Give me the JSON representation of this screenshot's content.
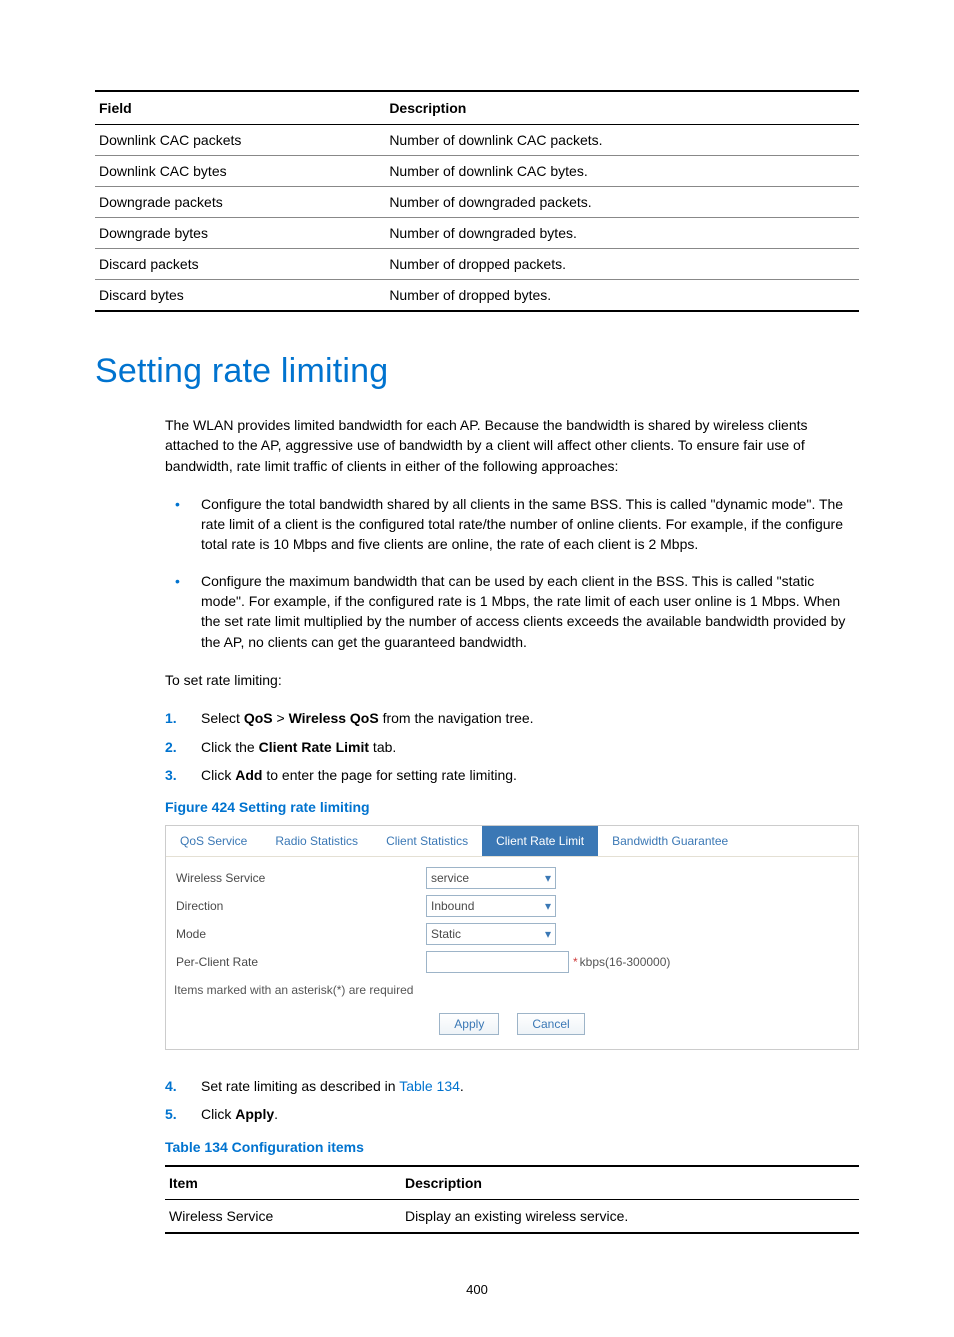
{
  "table1": {
    "headers": {
      "field": "Field",
      "desc": "Description"
    },
    "rows": [
      {
        "field": "Downlink CAC packets",
        "desc": "Number of downlink CAC packets."
      },
      {
        "field": "Downlink CAC bytes",
        "desc": "Number of downlink CAC bytes."
      },
      {
        "field": "Downgrade packets",
        "desc": "Number of downgraded packets."
      },
      {
        "field": "Downgrade bytes",
        "desc": "Number of downgraded bytes."
      },
      {
        "field": "Discard packets",
        "desc": "Number of dropped packets."
      },
      {
        "field": "Discard bytes",
        "desc": "Number of dropped bytes."
      }
    ]
  },
  "heading": "Setting rate limiting",
  "intro": "The WLAN provides limited bandwidth for each AP. Because the bandwidth is shared by wireless clients attached to the AP, aggressive use of bandwidth by a client will affect other clients. To ensure fair use of bandwidth, rate limit traffic of clients in either of the following approaches:",
  "bullets": [
    "Configure the total bandwidth shared by all clients in the same BSS. This is called \"dynamic mode\". The rate limit of a client is the configured total rate/the number of online clients. For example, if the configure total rate is 10 Mbps and five clients are online, the rate of each client is 2 Mbps.",
    "Configure the maximum bandwidth that can be used by each client in the BSS. This is called \"static mode\". For example, if the configured rate is 1 Mbps, the rate limit of each user online is 1 Mbps. When the set rate limit multiplied by the number of access clients exceeds the available bandwidth provided by the AP, no clients can get the guaranteed bandwidth."
  ],
  "lead2": "To set rate limiting:",
  "steps1": {
    "s1a": "Select ",
    "s1b": "QoS",
    "s1c": " > ",
    "s1d": "Wireless QoS",
    "s1e": " from the navigation tree.",
    "s2a": "Click the ",
    "s2b": "Client Rate Limit",
    "s2c": " tab.",
    "s3a": "Click ",
    "s3b": "Add",
    "s3c": " to enter the page for setting rate limiting."
  },
  "figcaption": "Figure 424 Setting rate limiting",
  "tabs": {
    "qos": "QoS Service",
    "radio": "Radio Statistics",
    "client": "Client Statistics",
    "rate": "Client Rate Limit",
    "bw": "Bandwidth Guarantee"
  },
  "form": {
    "wireless_label": "Wireless Service",
    "wireless_value": "service",
    "direction_label": "Direction",
    "direction_value": "Inbound",
    "mode_label": "Mode",
    "mode_value": "Static",
    "rate_label": "Per-Client Rate",
    "rate_value": "",
    "rate_unit": "kbps(16-300000)",
    "note": "Items marked with an asterisk(*) are required",
    "apply": "Apply",
    "cancel": "Cancel",
    "asterisk": "*"
  },
  "steps2": {
    "s4a": "Set rate limiting as described in ",
    "s4b": "Table 134",
    "s4c": ".",
    "s5a": "Click ",
    "s5b": "Apply",
    "s5c": "."
  },
  "table2caption": "Table 134 Configuration items",
  "table2": {
    "headers": {
      "item": "Item",
      "desc": "Description"
    },
    "rows": [
      {
        "item": "Wireless Service",
        "desc": "Display an existing wireless service."
      }
    ]
  },
  "pagenum": "400"
}
